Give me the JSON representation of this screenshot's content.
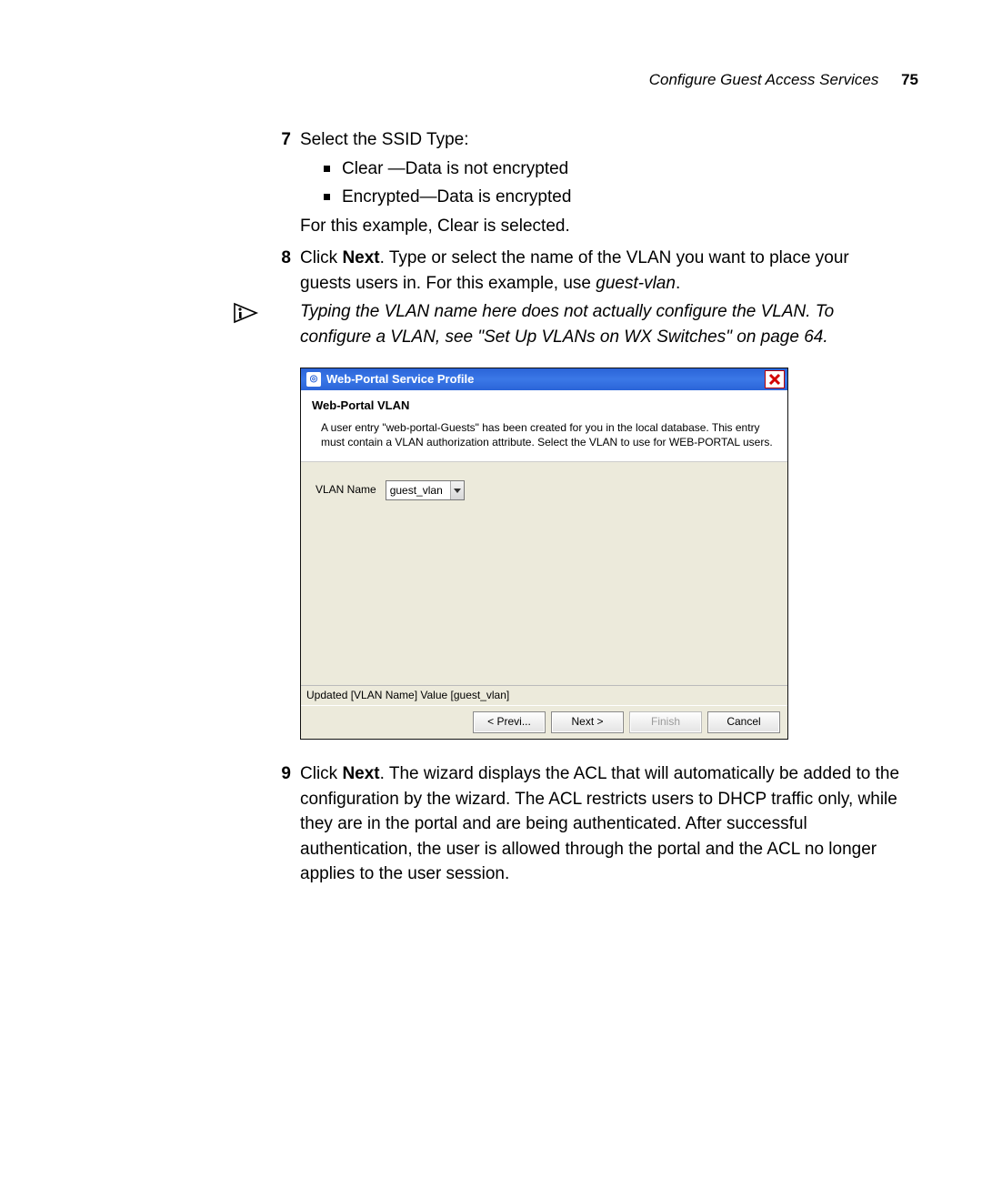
{
  "header": {
    "running_title": "Configure Guest Access Services",
    "page_number": "75"
  },
  "steps": {
    "s7": {
      "num": "7",
      "text": "Select the SSID Type:",
      "bullets": {
        "b1": "Clear —Data is not encrypted",
        "b2": "Encrypted—Data is encrypted"
      },
      "followup": "For this example, Clear is selected."
    },
    "s8": {
      "num": "8",
      "pre": "Click ",
      "bold": "Next",
      "post": ". Type or select the name of the VLAN you want to place your guests users in. For this example, use ",
      "ital": "guest-vlan",
      "end": "."
    },
    "note": "Typing the VLAN name here does not actually configure the VLAN. To configure a VLAN, see \"Set Up VLANs on WX Switches\" on page 64.",
    "s9": {
      "num": "9",
      "pre": "Click ",
      "bold": "Next",
      "post": ". The wizard displays the ACL that will automatically be added to the configuration by the wizard. The ACL restricts users to DHCP traffic only, while they are in the portal and are being authenticated. After successful authentication, the user is allowed through the portal and the ACL no longer applies to the user session."
    }
  },
  "wizard": {
    "title": "Web-Portal Service Profile",
    "subtitle": "Web-Portal VLAN",
    "description": "A user entry \"web-portal-Guests\" has been created for you in the local database. This entry must contain a VLAN authorization attribute. Select the VLAN to use for WEB-PORTAL users.",
    "field_label": "VLAN Name",
    "field_value": "guest_vlan",
    "status": "Updated [VLAN Name] Value [guest_vlan]",
    "buttons": {
      "prev": "< Previ...",
      "next": "Next >",
      "finish": "Finish",
      "cancel": "Cancel"
    }
  }
}
